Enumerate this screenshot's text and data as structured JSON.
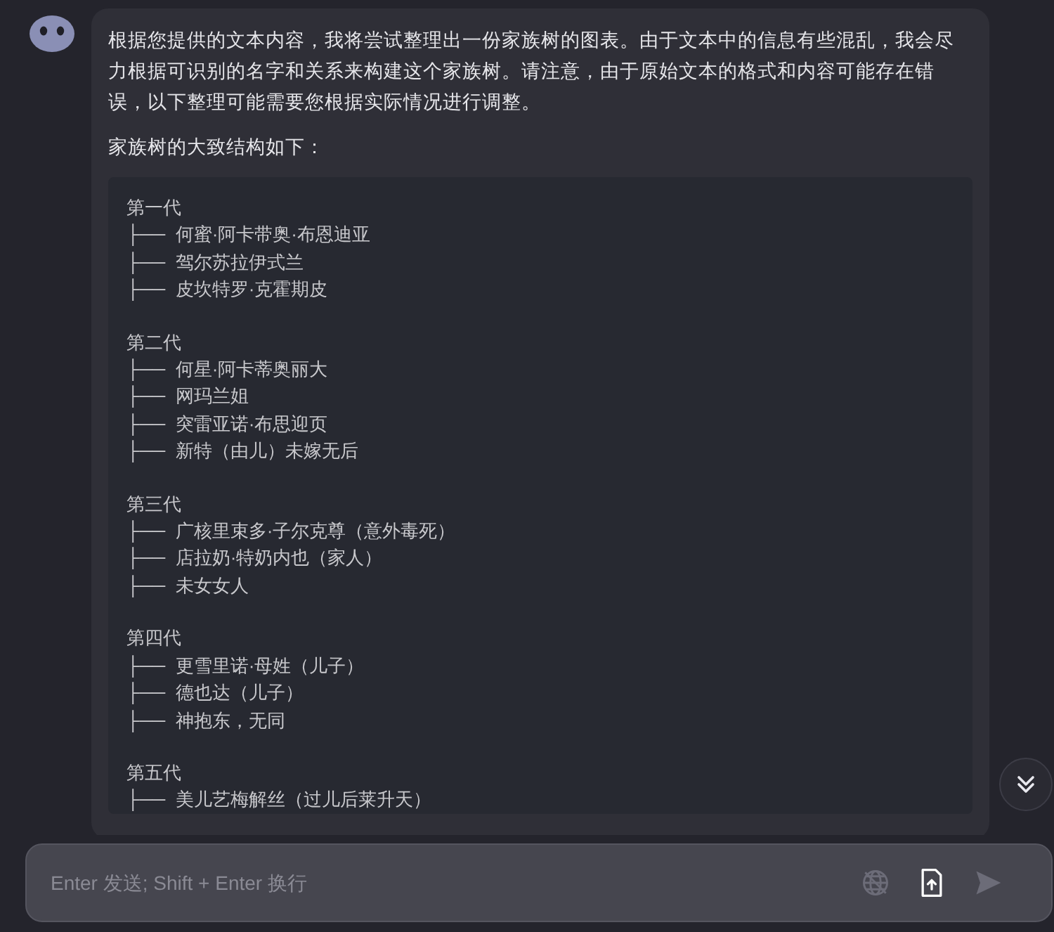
{
  "message": {
    "paragraphs": [
      "根据您提供的文本内容，我将尝试整理出一份家族树的图表。由于文本中的信息有些混乱，我会尽力根据可识别的名字和关系来构建这个家族树。请注意，由于原始文本的格式和内容可能存在错误，以下整理可能需要您根据实际情况进行调整。",
      "家族树的大致结构如下："
    ],
    "code": [
      {
        "heading": "第一代",
        "lines": [
          "├──  何蜜·阿卡带奥·布恩迪亚",
          "├──  驾尔苏拉伊式兰",
          "├──  皮坎特罗·克霍期皮"
        ]
      },
      {
        "heading": "第二代",
        "lines": [
          "├──  何星·阿卡蒂奥丽大",
          "├──  网玛兰姐",
          "├──  突雷亚诺·布思迎页",
          "├──  新特（由儿）未嫁无后"
        ]
      },
      {
        "heading": "第三代",
        "lines": [
          "├──  广核里束多·子尔克尊（意外毒死）",
          "├──  店拉奶·特奶内也（家人）",
          "├──  未女女人"
        ]
      },
      {
        "heading": "第四代",
        "lines": [
          "├──  更雪里诺·母姓（儿子）",
          "├──  德也达（儿子）",
          "├──  神抱东，无同"
        ]
      },
      {
        "heading": "第五代",
        "lines": [
          "├──  美儿艺梅解丝（过儿后莱升天）"
        ]
      }
    ]
  },
  "composer": {
    "placeholder": "Enter 发送; Shift + Enter 换行",
    "web_search": false
  }
}
